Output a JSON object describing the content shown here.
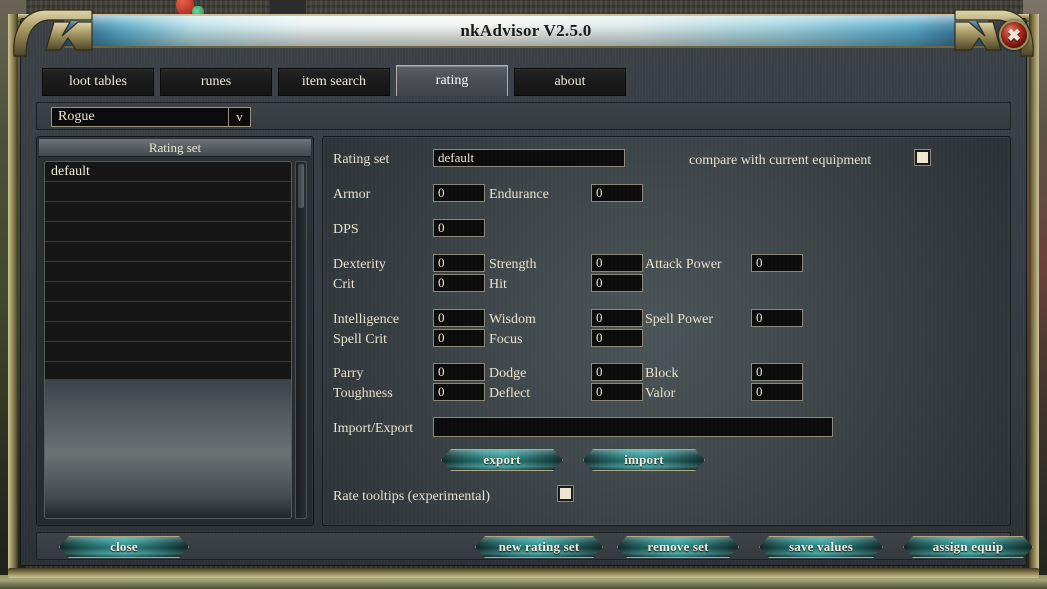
{
  "window": {
    "title": "nkAdvisor V2.5.0",
    "close_label": "✖"
  },
  "tabs": [
    {
      "label": "loot tables",
      "active": false
    },
    {
      "label": "runes",
      "active": false
    },
    {
      "label": "item search",
      "active": false
    },
    {
      "label": "rating",
      "active": true
    },
    {
      "label": "about",
      "active": false
    }
  ],
  "class_selector": {
    "value": "Rogue",
    "arrow": "v"
  },
  "left_panel": {
    "header": "Rating set",
    "rows": [
      "default",
      "",
      "",
      "",
      "",
      "",
      "",
      "",
      "",
      ""
    ]
  },
  "form": {
    "rating_set_label": "Rating set",
    "rating_set_value": "default",
    "compare_label": "compare with current equipment",
    "compare_checked": false,
    "rate_tooltips_label": "Rate tooltips (experimental)",
    "rate_tooltips_checked": false,
    "import_export_label": "Import/Export",
    "import_export_value": "",
    "stats": [
      {
        "label": "Armor",
        "value": "0"
      },
      {
        "label": "Endurance",
        "value": "0"
      },
      {
        "label": "DPS",
        "value": "0"
      },
      {
        "label": "Dexterity",
        "value": "0"
      },
      {
        "label": "Strength",
        "value": "0"
      },
      {
        "label": "Attack Power",
        "value": "0"
      },
      {
        "label": "Crit",
        "value": "0"
      },
      {
        "label": "Hit",
        "value": "0"
      },
      {
        "label": "Intelligence",
        "value": "0"
      },
      {
        "label": "Wisdom",
        "value": "0"
      },
      {
        "label": "Spell Power",
        "value": "0"
      },
      {
        "label": "Spell Crit",
        "value": "0"
      },
      {
        "label": "Focus",
        "value": "0"
      },
      {
        "label": "Parry",
        "value": "0"
      },
      {
        "label": "Dodge",
        "value": "0"
      },
      {
        "label": "Block",
        "value": "0"
      },
      {
        "label": "Toughness",
        "value": "0"
      },
      {
        "label": "Deflect",
        "value": "0"
      },
      {
        "label": "Valor",
        "value": "0"
      }
    ],
    "export_button": "export",
    "import_button": "import"
  },
  "footer": {
    "close": "close",
    "new_rating_set": "new rating set",
    "remove_set": "remove set",
    "save_values": "save values",
    "assign_equip": "assign equip"
  },
  "colors": {
    "accent_teal": "#37a09c",
    "gold_frame": "#a89a65",
    "label_text": "#ece4cf",
    "field_bg": "#0a0a0a",
    "close_orb": "#bb2f22"
  }
}
